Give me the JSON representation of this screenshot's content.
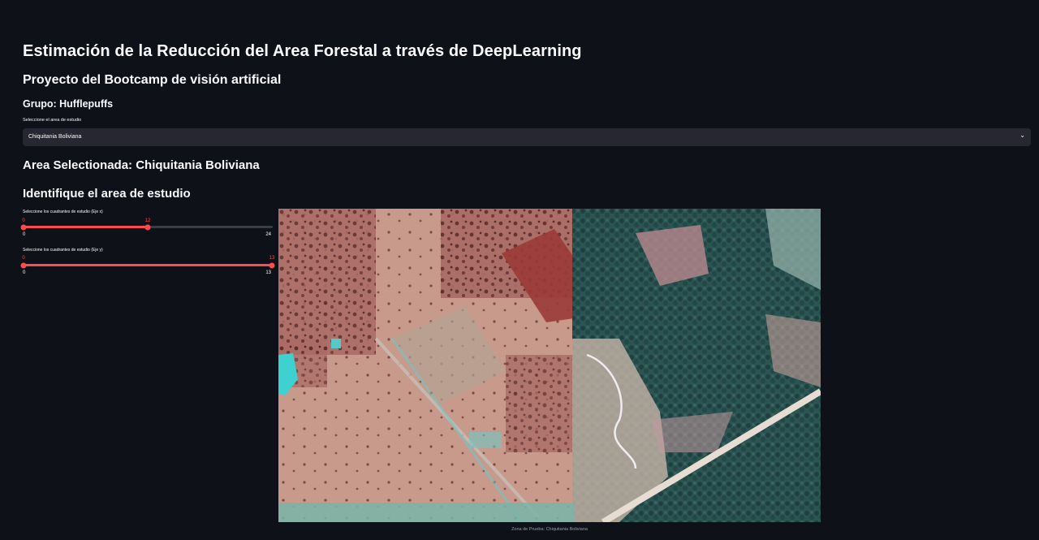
{
  "header": {
    "title": "Estimación de la Reducción del Area Forestal a través de DeepLearning",
    "subtitle": "Proyecto del Bootcamp de visión artificial",
    "group": "Grupo: Hufflepuffs"
  },
  "area_select": {
    "label": "Seleccione el area de estudio",
    "selected": "Chiquitania Boliviana",
    "chevron": "⌄"
  },
  "selected_area_title": "Area Selectionada: Chiquitania Boliviana",
  "identify_title": "Identifique el area de estudio",
  "slider_x": {
    "label": "Seleccione los cuadrantes de estudio (Eje x)",
    "min": 0,
    "max": 24,
    "low": 0,
    "high": 12,
    "low_text": "0",
    "high_text": "12",
    "min_text": "0",
    "max_text": "24"
  },
  "slider_y": {
    "label": "Seleccione los cuadrantes de estudio (Eje y)",
    "min": 0,
    "max": 13,
    "low": 0,
    "high": 13,
    "low_text": "0",
    "high_text": "13",
    "min_text": "0",
    "max_text": "13"
  },
  "map": {
    "caption": "Zona de Prueba: Chiquitania Boliviana",
    "colors": {
      "accent": "#ff4b4b",
      "background": "#0e1117",
      "select_bg": "#262730"
    }
  }
}
